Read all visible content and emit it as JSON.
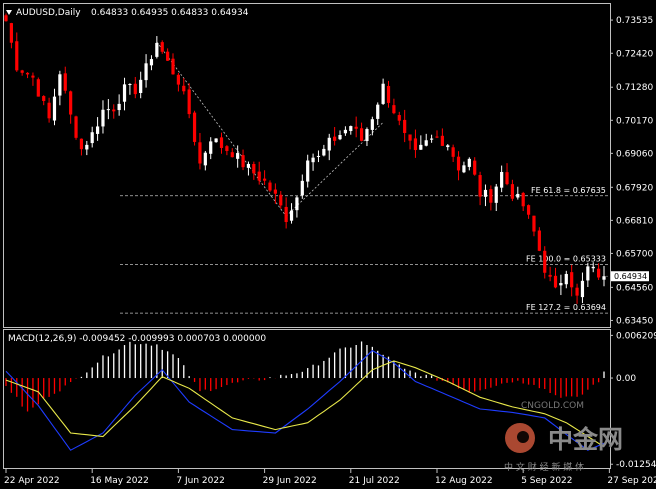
{
  "chart_data": [
    {
      "type": "candlestick",
      "symbol_header": "AUDUSD,Daily",
      "ohlc_header": "0.64833 0.64935 0.64833 0.64934",
      "last_price_label": "0.64934",
      "y_tick_labels": [
        "0.73535",
        "0.72420",
        "0.71280",
        "0.70170",
        "0.69060",
        "0.67920",
        "0.66810",
        "0.65700",
        "0.64560",
        "0.63450"
      ],
      "y_ticks": [
        0.73535,
        0.7242,
        0.7128,
        0.7017,
        0.6906,
        0.6792,
        0.6681,
        0.657,
        0.6456,
        0.6345
      ],
      "ylim": [
        0.6333,
        0.7394
      ],
      "x_tick_labels": [
        "22 Apr 2022",
        "16 May 2022",
        "7 Jun 2022",
        "29 Jun 2022",
        "21 Jul 2022",
        "12 Aug 2022",
        "5 Sep 2022",
        "27 Sep 2022"
      ],
      "x_tick_index": [
        0,
        16,
        32,
        48,
        64,
        80,
        96,
        112
      ],
      "fe_levels": [
        {
          "label": "FE 61.8 = 0.67635",
          "value": 0.67635
        },
        {
          "label": "FE 100.0 = 0.65333",
          "value": 0.65333
        },
        {
          "label": "FE 127.2 = 0.63694",
          "value": 0.63694
        }
      ],
      "anchors": [
        {
          "from_index": 28,
          "from_value": 0.728,
          "to_index": 52,
          "to_value": 0.6695
        },
        {
          "from_index": 52,
          "from_value": 0.6695,
          "to_index": 70,
          "to_value": 0.701
        }
      ],
      "colors": {
        "bull": "#ffffff",
        "bear": "#ff0000",
        "grid": "#c0c0c0",
        "anchor": "#c0c0c0"
      },
      "key_closes": [
        [
          0,
          0.735
        ],
        [
          2,
          0.72
        ],
        [
          5,
          0.716
        ],
        [
          8,
          0.702
        ],
        [
          10,
          0.718
        ],
        [
          12,
          0.703
        ],
        [
          14,
          0.692
        ],
        [
          16,
          0.697
        ],
        [
          18,
          0.705
        ],
        [
          20,
          0.706
        ],
        [
          22,
          0.712
        ],
        [
          24,
          0.712
        ],
        [
          26,
          0.719
        ],
        [
          28,
          0.728
        ],
        [
          30,
          0.721
        ],
        [
          32,
          0.715
        ],
        [
          34,
          0.704
        ],
        [
          36,
          0.687
        ],
        [
          38,
          0.696
        ],
        [
          40,
          0.693
        ],
        [
          42,
          0.691
        ],
        [
          44,
          0.687
        ],
        [
          46,
          0.684
        ],
        [
          48,
          0.681
        ],
        [
          50,
          0.676
        ],
        [
          52,
          0.669
        ],
        [
          54,
          0.676
        ],
        [
          56,
          0.69
        ],
        [
          58,
          0.689
        ],
        [
          60,
          0.694
        ],
        [
          62,
          0.697
        ],
        [
          64,
          0.7
        ],
        [
          66,
          0.695
        ],
        [
          68,
          0.703
        ],
        [
          70,
          0.713
        ],
        [
          72,
          0.705
        ],
        [
          74,
          0.696
        ],
        [
          76,
          0.69
        ],
        [
          78,
          0.694
        ],
        [
          80,
          0.696
        ],
        [
          82,
          0.694
        ],
        [
          84,
          0.686
        ],
        [
          86,
          0.688
        ],
        [
          88,
          0.677
        ],
        [
          90,
          0.676
        ],
        [
          92,
          0.684
        ],
        [
          94,
          0.677
        ],
        [
          96,
          0.673
        ],
        [
          98,
          0.664
        ],
        [
          100,
          0.652
        ],
        [
          102,
          0.644
        ],
        [
          104,
          0.652
        ],
        [
          106,
          0.642
        ],
        [
          108,
          0.652
        ],
        [
          110,
          0.65
        ],
        [
          111,
          0.6493
        ]
      ]
    },
    {
      "type": "macd",
      "header": "MACD(12,26,9) -0.009452 -0.009993 0.000703 0.000000",
      "y_tick_labels": [
        "0.006209",
        "0.00",
        "-0.012542"
      ],
      "y_ticks": [
        0.006209,
        0.0,
        -0.012542
      ],
      "ylim": [
        -0.0128,
        0.0067
      ],
      "histogram_anchors": [
        [
          0,
          -0.001
        ],
        [
          4,
          -0.005
        ],
        [
          8,
          -0.0025
        ],
        [
          12,
          -0.0008
        ],
        [
          18,
          0.003
        ],
        [
          23,
          0.0052
        ],
        [
          28,
          0.0049
        ],
        [
          32,
          0.0028
        ],
        [
          36,
          -0.002
        ],
        [
          40,
          -0.0012
        ],
        [
          44,
          -0.0005
        ],
        [
          50,
          0.0001
        ],
        [
          56,
          0.0012
        ],
        [
          62,
          0.004
        ],
        [
          66,
          0.0052
        ],
        [
          70,
          0.0035
        ],
        [
          74,
          0.0012
        ],
        [
          78,
          0.0003
        ],
        [
          82,
          -0.0006
        ],
        [
          86,
          -0.002
        ],
        [
          90,
          -0.0012
        ],
        [
          94,
          -0.0004
        ],
        [
          98,
          -0.0008
        ],
        [
          102,
          -0.0025
        ],
        [
          106,
          -0.003
        ],
        [
          110,
          -0.0004
        ],
        [
          111,
          0.0007
        ]
      ],
      "macd_anchors": [
        [
          0,
          0.001
        ],
        [
          6,
          -0.004
        ],
        [
          12,
          -0.0105
        ],
        [
          18,
          -0.008
        ],
        [
          24,
          -0.0025
        ],
        [
          29,
          0.0012
        ],
        [
          34,
          -0.0035
        ],
        [
          42,
          -0.0075
        ],
        [
          50,
          -0.008
        ],
        [
          56,
          -0.0045
        ],
        [
          62,
          -0.0005
        ],
        [
          68,
          0.004
        ],
        [
          72,
          0.0022
        ],
        [
          76,
          -0.0005
        ],
        [
          82,
          -0.0025
        ],
        [
          88,
          -0.0045
        ],
        [
          94,
          -0.005
        ],
        [
          100,
          -0.0058
        ],
        [
          104,
          -0.0082
        ],
        [
          108,
          -0.0105
        ],
        [
          111,
          -0.0095
        ]
      ],
      "signal_anchors": [
        [
          0,
          -0.0003
        ],
        [
          6,
          -0.002
        ],
        [
          12,
          -0.008
        ],
        [
          18,
          -0.0085
        ],
        [
          24,
          -0.004
        ],
        [
          29,
          0.0002
        ],
        [
          34,
          -0.0015
        ],
        [
          42,
          -0.0058
        ],
        [
          50,
          -0.0075
        ],
        [
          56,
          -0.0065
        ],
        [
          62,
          -0.0032
        ],
        [
          68,
          0.0012
        ],
        [
          72,
          0.0025
        ],
        [
          76,
          0.0015
        ],
        [
          82,
          -0.0005
        ],
        [
          88,
          -0.0028
        ],
        [
          94,
          -0.0042
        ],
        [
          100,
          -0.0052
        ],
        [
          104,
          -0.0065
        ],
        [
          108,
          -0.0085
        ],
        [
          111,
          -0.01
        ]
      ],
      "colors": {
        "hist_pos": "#ffffff",
        "hist_neg": "#ff0000",
        "macd": "#1e3cff",
        "signal": "#e8e84a"
      }
    }
  ],
  "watermark": {
    "cn_text": "中金网",
    "subtext": "中 文 财 经 新 媒 体",
    "url": "CNGOLD.COM"
  }
}
